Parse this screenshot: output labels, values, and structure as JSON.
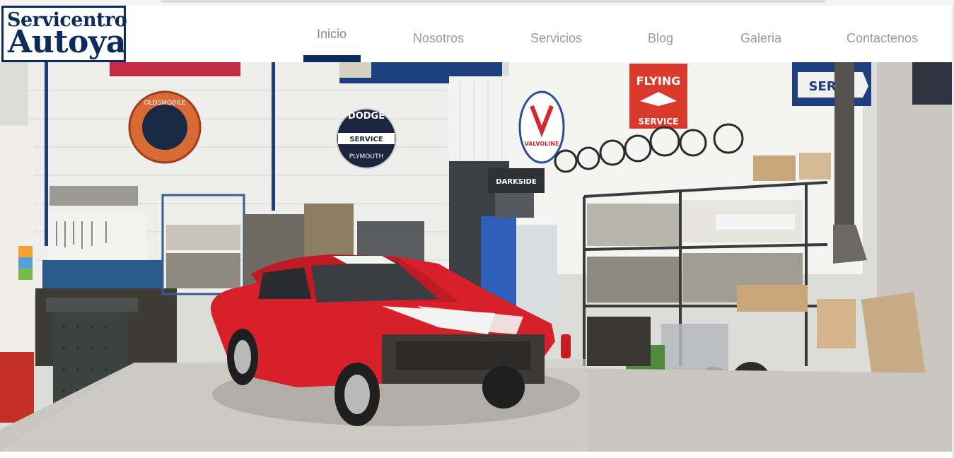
{
  "logo": {
    "line1": "Servicentro",
    "line2": "Autoya"
  },
  "nav": {
    "items": [
      {
        "label": "Inicio",
        "active": true
      },
      {
        "label": "Nosotros",
        "active": false
      },
      {
        "label": "Servicios",
        "active": false
      },
      {
        "label": "Blog",
        "active": false
      },
      {
        "label": "Galeria",
        "active": false
      },
      {
        "label": "Contactenos",
        "active": false
      }
    ]
  },
  "hero": {
    "signs": {
      "oldsmobile": "OLDSMOBILE",
      "dodge_top": "DODGE",
      "dodge_mid": "SERVICE",
      "dodge_bottom": "PLYMOUTH",
      "valvoline": "VALVOLINE",
      "flying_top": "FLYING",
      "flying_bottom": "SERVICE",
      "service_right": "SERV",
      "darkside": "DARKSIDE"
    }
  },
  "colors": {
    "brand": "#0c2a5b",
    "nav_text": "#9a9a9a",
    "car_red": "#d8202a"
  }
}
